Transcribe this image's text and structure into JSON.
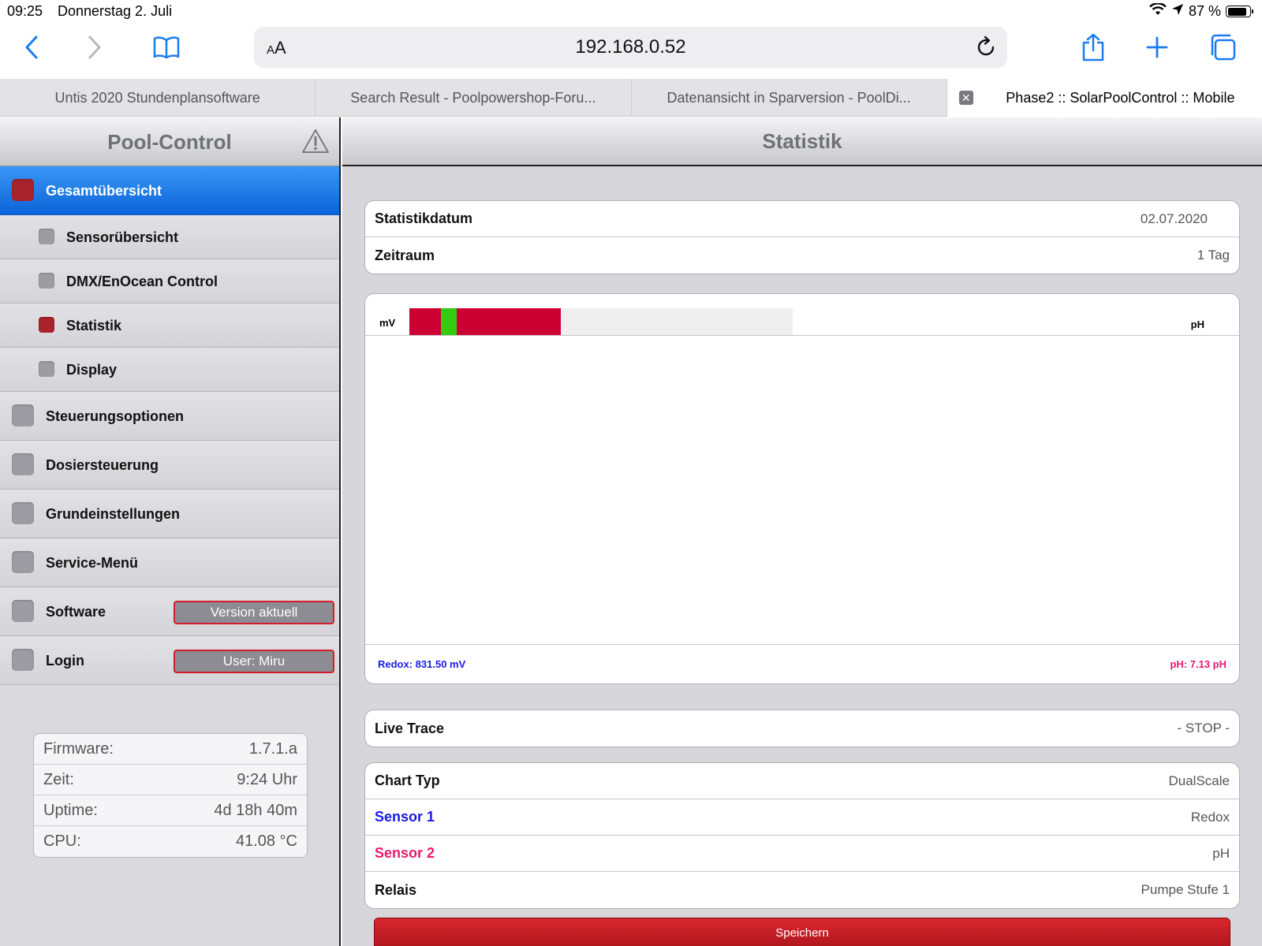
{
  "status": {
    "time": "09:25",
    "date": "Donnerstag 2. Juli",
    "battery": "87 %"
  },
  "browser": {
    "aa_small": "A",
    "aa_big": "A",
    "url": "192.168.0.52",
    "tabs": [
      "Untis 2020 Stundenplansoftware",
      "Search Result - Poolpowershop-Foru...",
      "Datenansicht in Sparversion - PoolDi...",
      "Phase2 :: SolarPoolControl :: Mobile"
    ]
  },
  "sidebar": {
    "title": "Pool-Control",
    "items": [
      {
        "label": "Gesamtübersicht"
      },
      {
        "label": "Sensorübersicht"
      },
      {
        "label": "DMX/EnOcean Control"
      },
      {
        "label": "Statistik"
      },
      {
        "label": "Display"
      },
      {
        "label": "Steuerungsoptionen"
      },
      {
        "label": "Dosiersteuerung"
      },
      {
        "label": "Grundeinstellungen"
      },
      {
        "label": "Service-Menü"
      },
      {
        "label": "Software",
        "pill": "Version aktuell"
      },
      {
        "label": "Login",
        "pill": "User: Miru"
      }
    ],
    "info": [
      {
        "k": "Firmware:",
        "v": "1.7.1.a"
      },
      {
        "k": "Zeit:",
        "v": "9:24 Uhr"
      },
      {
        "k": "Uptime:",
        "v": "4d 18h 40m"
      },
      {
        "k": "CPU:",
        "v": "41.08 °C"
      }
    ]
  },
  "main": {
    "title": "Statistik",
    "date_group": [
      {
        "k": "Statistikdatum",
        "v": "02.07.2020"
      },
      {
        "k": "Zeitraum",
        "v": "1 Tag"
      }
    ],
    "chart": {
      "unit_left": "mV",
      "unit_right": "pH",
      "redox_label": "Redox: 831.50 mV",
      "ph_label": "pH: 7.13 pH"
    },
    "live_trace": {
      "k": "Live Trace",
      "v": "- STOP -"
    },
    "settings": [
      {
        "k": "Chart Typ",
        "v": "DualScale"
      },
      {
        "k": "Sensor 1",
        "v": "Redox"
      },
      {
        "k": "Sensor 2",
        "v": "pH"
      },
      {
        "k": "Relais",
        "v": "Pumpe Stufe 1"
      }
    ],
    "save_label": "Speichern"
  },
  "colors": {
    "accent_blue": "#0b64d8",
    "status_red": "#cc0033",
    "status_green": "#33cc11",
    "sensor1": "#1a1ae6",
    "sensor2": "#e8196e"
  }
}
